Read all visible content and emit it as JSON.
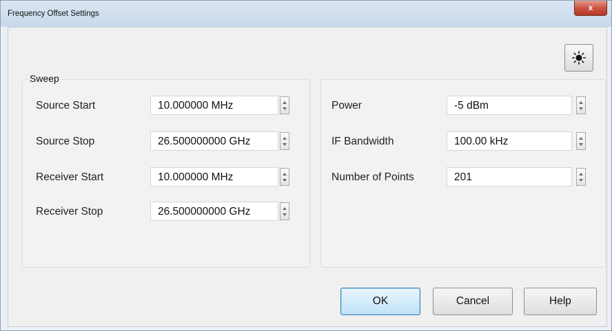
{
  "window": {
    "title": "Frequency Offset Settings",
    "close_glyph": "x"
  },
  "toolbar": {
    "sun_icon": "sun-icon"
  },
  "sweep": {
    "group_label": "Sweep",
    "fields": [
      {
        "label": "Source Start",
        "value": "10.000000 MHz"
      },
      {
        "label": "Source Stop",
        "value": "26.500000000 GHz"
      },
      {
        "label": "Receiver Start",
        "value": "10.000000 MHz"
      },
      {
        "label": "Receiver Stop",
        "value": "26.500000000 GHz"
      }
    ]
  },
  "settings": {
    "fields": [
      {
        "label": "Power",
        "value": "-5 dBm"
      },
      {
        "label": "IF Bandwidth",
        "value": "100.00 kHz"
      },
      {
        "label": "Number of Points",
        "value": "201"
      }
    ]
  },
  "buttons": {
    "ok": "OK",
    "cancel": "Cancel",
    "help": "Help"
  },
  "colors": {
    "default_button": "#bfe3f8",
    "close_button": "#c9503c"
  }
}
